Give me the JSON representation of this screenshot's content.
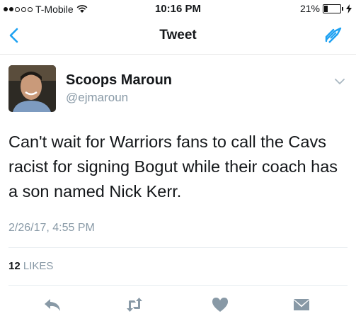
{
  "status_bar": {
    "carrier": "T-Mobile",
    "time": "10:16 PM",
    "battery": "21%",
    "battery_level": 0.21
  },
  "nav": {
    "title": "Tweet",
    "back_icon": "chevron-left-icon",
    "compose_icon": "compose-tweet-icon"
  },
  "tweet": {
    "author_name": "Scoops Maroun",
    "author_handle": "@ejmaroun",
    "text": "Can't wait for Warriors fans to call the Cavs racist for signing Bogut while their coach has a son named Nick Kerr.",
    "timestamp": "2/26/17, 4:55 PM",
    "likes_count": "12",
    "likes_label": "LIKES"
  },
  "actions": {
    "reply_icon": "reply-icon",
    "retweet_icon": "retweet-icon",
    "like_icon": "heart-icon",
    "dm_icon": "direct-message-icon"
  },
  "colors": {
    "accent": "#1da1f2",
    "secondary_text": "#8899a6",
    "icon_gray": "#8899a6",
    "divider": "#e6ecf0"
  }
}
